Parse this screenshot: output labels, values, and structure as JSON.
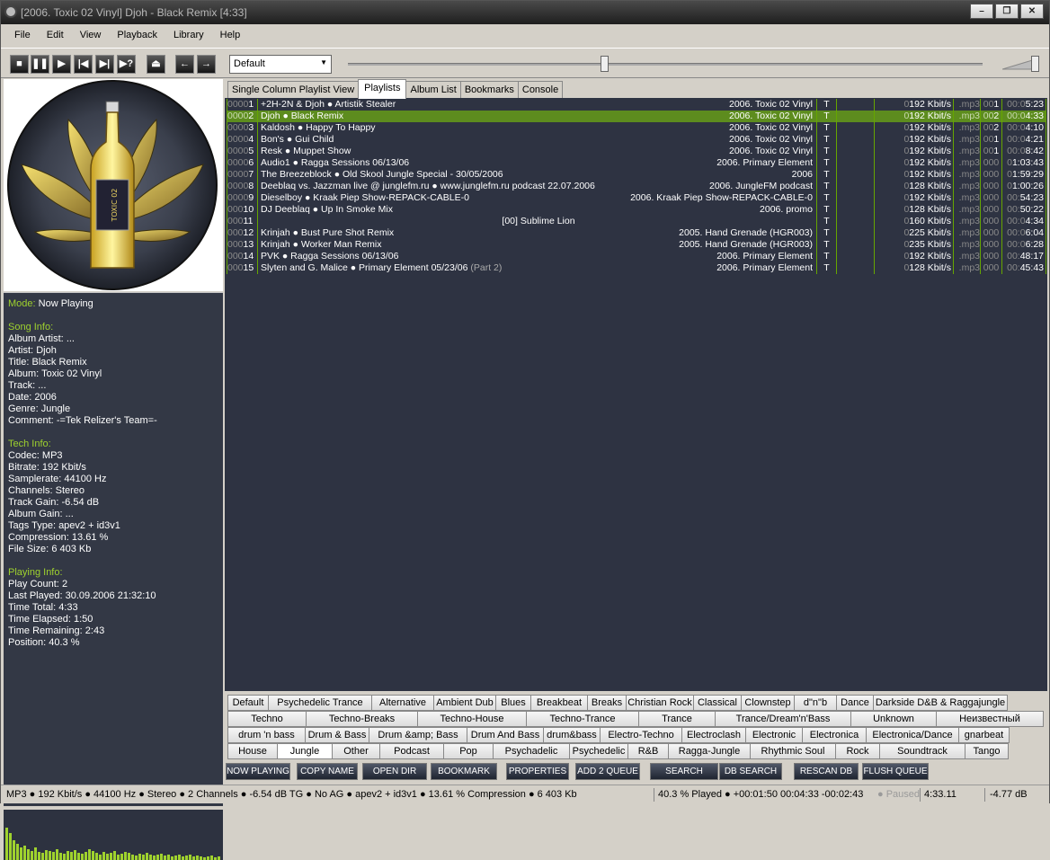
{
  "title": "[2006. Toxic 02 Vinyl] Djoh - Black Remix [4:33]",
  "window_buttons": [
    "–",
    "❐",
    "✕"
  ],
  "menu": [
    "File",
    "Edit",
    "View",
    "Playback",
    "Library",
    "Help"
  ],
  "toolbar": {
    "preset": "Default",
    "seek_fraction": 0.403,
    "volume_fraction": 1.0
  },
  "album_art_text": "TOXIC 02",
  "info": {
    "mode_label": "Mode:",
    "mode_value": "Now Playing",
    "song_header": "Song Info:",
    "song": [
      {
        "k": "Album Artist:",
        "v": "..."
      },
      {
        "k": "Artist:",
        "v": "Djoh"
      },
      {
        "k": "Title:",
        "v": "Black Remix"
      },
      {
        "k": "Album:",
        "v": "Toxic 02 Vinyl"
      },
      {
        "k": "Track:",
        "v": "..."
      },
      {
        "k": "Date:",
        "v": "2006"
      },
      {
        "k": "Genre:",
        "v": "Jungle"
      },
      {
        "k": "Comment:",
        "v": "-=Tek Relizer's Team=-"
      }
    ],
    "tech_header": "Tech Info:",
    "tech": [
      {
        "k": "Codec:",
        "v": "MP3"
      },
      {
        "k": "Bitrate:",
        "v": "192 Kbit/s"
      },
      {
        "k": "Samplerate:",
        "v": "44100 Hz"
      },
      {
        "k": "Channels:",
        "v": "Stereo"
      },
      {
        "k": "Track Gain:",
        "v": "-6.54 dB"
      },
      {
        "k": "Album Gain:",
        "v": "..."
      },
      {
        "k": "Tags Type:",
        "v": "apev2 + id3v1"
      },
      {
        "k": "Compression:",
        "v": "13.61 %"
      },
      {
        "k": "File Size:",
        "v": "6 403 Kb"
      }
    ],
    "play_header": "Playing Info:",
    "play": [
      {
        "k": "Play Count:",
        "v": "2"
      },
      {
        "k": "Last Played:",
        "v": "30.09.2006 21:32:10"
      },
      {
        "k": "Time Total:",
        "v": "4:33"
      },
      {
        "k": "Time Elapsed:",
        "v": "1:50"
      },
      {
        "k": "Time Remaining:",
        "v": "2:43"
      },
      {
        "k": "Position:",
        "v": "40.3 %"
      }
    ]
  },
  "tabs": [
    "Single Column Playlist View",
    "Playlists",
    "Album List",
    "Bookmarks",
    "Console"
  ],
  "active_tab": 1,
  "playlist": [
    {
      "np": "0000",
      "n": "1",
      "title": "+2H-2N & Djoh ● Artistik Stealer",
      "album": "2006. Toxic 02 Vinyl",
      "t": "T",
      "brp": "0",
      "br": "192 Kbit/s",
      "ext": ".mp3",
      "cp": "00",
      "c": "1",
      "tp": "00:0",
      "time": "5:23"
    },
    {
      "np": "0000",
      "n": "2",
      "title": "Djoh ● Black Remix",
      "album": "2006. Toxic 02 Vinyl",
      "t": "T",
      "brp": "0",
      "br": "192 Kbit/s",
      "ext": ".mp3",
      "cp": "00",
      "c": "2",
      "tp": "00:0",
      "time": "4:33",
      "sel": true
    },
    {
      "np": "0000",
      "n": "3",
      "title": "Kaldosh ● Happy To Happy",
      "album": "2006. Toxic 02 Vinyl",
      "t": "T",
      "brp": "0",
      "br": "192 Kbit/s",
      "ext": ".mp3",
      "cp": "00",
      "c": "2",
      "tp": "00:0",
      "time": "4:10"
    },
    {
      "np": "0000",
      "n": "4",
      "title": "Bon's ● Gui Child",
      "album": "2006. Toxic 02 Vinyl",
      "t": "T",
      "brp": "0",
      "br": "192 Kbit/s",
      "ext": ".mp3",
      "cp": "00",
      "c": "1",
      "tp": "00:0",
      "time": "4:21"
    },
    {
      "np": "0000",
      "n": "5",
      "title": "Resk ● Muppet Show",
      "album": "2006. Toxic 02 Vinyl",
      "t": "T",
      "brp": "0",
      "br": "192 Kbit/s",
      "ext": ".mp3",
      "cp": "00",
      "c": "1",
      "tp": "00:0",
      "time": "8:42"
    },
    {
      "np": "0000",
      "n": "6",
      "title": "Audio1 ● Ragga Sessions 06/13/06",
      "album": "2006. Primary Element",
      "t": "T",
      "brp": "0",
      "br": "192 Kbit/s",
      "ext": ".mp3",
      "cp": "000",
      "c": "",
      "tp": "0",
      "time": "1:03:43"
    },
    {
      "np": "0000",
      "n": "7",
      "title": "The Breezeblock ● Old Skool Jungle Special - 30/05/2006",
      "album": "2006",
      "t": "T",
      "brp": "0",
      "br": "192 Kbit/s",
      "ext": ".mp3",
      "cp": "000",
      "c": "",
      "tp": "0",
      "time": "1:59:29"
    },
    {
      "np": "0000",
      "n": "8",
      "title": "Deeblaq vs. Jazzman live @ junglefm.ru ● www.junglefm.ru podcast 22.07.2006",
      "album": "2006. JungleFM podcast",
      "t": "T",
      "brp": "0",
      "br": "128 Kbit/s",
      "ext": ".mp3",
      "cp": "000",
      "c": "",
      "tp": "0",
      "time": "1:00:26"
    },
    {
      "np": "0000",
      "n": "9",
      "title": "Dieselboy ● Kraak Piep Show-REPACK-CABLE-0",
      "album": "2006. Kraak Piep Show-REPACK-CABLE-0",
      "t": "T",
      "brp": "0",
      "br": "192 Kbit/s",
      "ext": ".mp3",
      "cp": "000",
      "c": "",
      "tp": "00:",
      "time": "54:23"
    },
    {
      "np": "000",
      "n": "10",
      "title": "DJ Deeblaq ● Up In Smoke Mix",
      "album": "2006. promo",
      "t": "T",
      "brp": "0",
      "br": "128 Kbit/s",
      "ext": ".mp3",
      "cp": "000",
      "c": "",
      "tp": "00:",
      "time": "50:22"
    },
    {
      "np": "000",
      "n": "11",
      "title": "",
      "center": "[00] Sublime Lion",
      "album": "",
      "t": "T",
      "brp": "0",
      "br": "160 Kbit/s",
      "ext": ".mp3",
      "cp": "000",
      "c": "",
      "tp": "00:0",
      "time": "4:34"
    },
    {
      "np": "000",
      "n": "12",
      "title": "Krinjah ● Bust Pure Shot Remix",
      "album": "2005. Hand Grenade (HGR003)",
      "t": "T",
      "brp": "0",
      "br": "225 Kbit/s",
      "ext": ".mp3",
      "cp": "000",
      "c": "",
      "tp": "00:0",
      "time": "6:04"
    },
    {
      "np": "000",
      "n": "13",
      "title": "Krinjah ● Worker Man Remix",
      "album": "2005. Hand Grenade (HGR003)",
      "t": "T",
      "brp": "0",
      "br": "235 Kbit/s",
      "ext": ".mp3",
      "cp": "000",
      "c": "",
      "tp": "00:0",
      "time": "6:28"
    },
    {
      "np": "000",
      "n": "14",
      "title": "PVK ● Ragga Sessions 06/13/06",
      "album": "2006. Primary Element",
      "t": "T",
      "brp": "0",
      "br": "192 Kbit/s",
      "ext": ".mp3",
      "cp": "000",
      "c": "",
      "tp": "00:",
      "time": "48:17"
    },
    {
      "np": "000",
      "n": "15",
      "title": "Slyten and G. Malice ● Primary Element 05/23/06",
      "extra": " (Part 2)",
      "album": "2006. Primary Element",
      "t": "T",
      "brp": "0",
      "br": "128 Kbit/s",
      "ext": ".mp3",
      "cp": "000",
      "c": "",
      "tp": "00:",
      "time": "45:43"
    }
  ],
  "genres": [
    [
      "Default",
      "Psychedelic Trance",
      "Alternative",
      "Ambient Dub",
      "Blues",
      "Breakbeat",
      "Breaks",
      "Christian Rock",
      "Classical",
      "Clownstep",
      "d\"n\"b",
      "Dance",
      "Darkside D&B & Raggajungle"
    ],
    [
      "Techno",
      "Techno-Breaks",
      "Techno-House",
      "Techno-Trance",
      "Trance",
      "Trance/Dream'n'Bass",
      "Unknown",
      "Неизвестный"
    ],
    [
      "drum 'n bass",
      "Drum & Bass",
      "Drum &amp; Bass",
      "Drum And Bass",
      "drum&bass",
      "Electro-Techno",
      "Electroclash",
      "Electronic",
      "Electronica",
      "Electronica/Dance",
      "gnarbeat"
    ],
    [
      "House",
      "Jungle",
      "Other",
      "Podcast",
      "Pop",
      "Psychadelic",
      "Psychedelic",
      "R&B",
      "Ragga-Jungle",
      "Rhythmic Soul",
      "Rock",
      "Soundtrack",
      "Tango"
    ]
  ],
  "active_genre": "Jungle",
  "actions": [
    "NOW PLAYING",
    "COPY NAME",
    "OPEN DIR",
    "BOOKMARK",
    "PROPERTIES",
    "ADD 2 QUEUE",
    "SEARCH",
    "DB SEARCH",
    "RESCAN DB",
    "FLUSH QUEUE"
  ],
  "status": {
    "left": "MP3 ● 192 Kbit/s ● 44100 Hz ● Stereo ● 2 Channels ● -6.54 dB TG ● No AG ● apev2 + id3v1 ● 13.61 % Compression ● 6 403 Kb",
    "played": "40.3 % Played ● +00:01:50  00:04:33  -00:02:43",
    "paused": "● Paused",
    "total": "4:33.11",
    "gain": "-4.77 dB"
  },
  "colors": {
    "accent": "#9fd22e",
    "panel": "#333845",
    "playlist_bg": "#2e3342",
    "selected": "#5d8c1e"
  }
}
